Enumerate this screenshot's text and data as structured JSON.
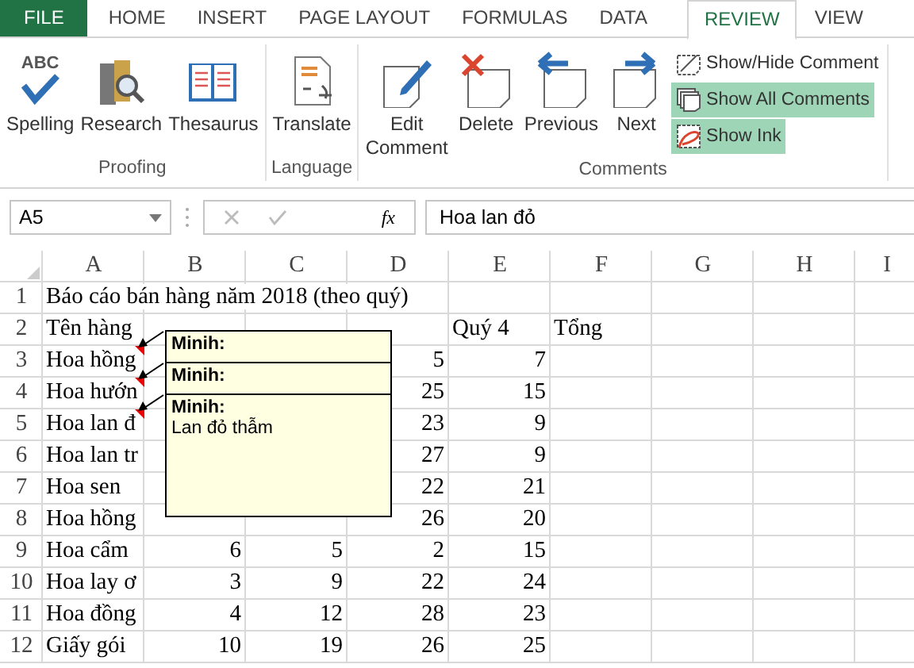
{
  "tabs": [
    {
      "label": "FILE",
      "kind": "file",
      "selected": false
    },
    {
      "label": "HOME",
      "kind": "tab",
      "selected": false
    },
    {
      "label": "INSERT",
      "kind": "tab",
      "selected": false
    },
    {
      "label": "PAGE LAYOUT",
      "kind": "tab",
      "selected": false
    },
    {
      "label": "FORMULAS",
      "kind": "tab",
      "selected": false
    },
    {
      "label": "DATA",
      "kind": "tab",
      "selected": false
    },
    {
      "label": "REVIEW",
      "kind": "tab",
      "selected": true
    },
    {
      "label": "VIEW",
      "kind": "tab",
      "selected": false
    }
  ],
  "ribbon": {
    "groups": [
      {
        "label": "Proofing",
        "buttons": [
          {
            "label": "Spelling",
            "kind": "spelling",
            "icon_text": "ABC"
          },
          {
            "label": "Research",
            "kind": "research"
          },
          {
            "label": "Thesaurus",
            "kind": "thesaurus"
          }
        ]
      },
      {
        "label": "Language",
        "buttons": [
          {
            "label": "Translate",
            "kind": "translate"
          }
        ]
      },
      {
        "label": "Comments",
        "buttons": [
          {
            "label": "Edit Comment",
            "kind": "edit"
          },
          {
            "label": "Delete",
            "kind": "delete"
          },
          {
            "label": "Previous",
            "kind": "previous"
          },
          {
            "label": "Next",
            "kind": "next"
          }
        ],
        "toggles": [
          {
            "label": "Show/Hide Comment",
            "kind": "showhide",
            "selected": false
          },
          {
            "label": "Show All Comments",
            "kind": "showall",
            "selected": true
          },
          {
            "label": "Show Ink",
            "kind": "ink",
            "selected": true
          }
        ]
      }
    ]
  },
  "formula_bar": {
    "name_box": "A5",
    "function_label": "fx",
    "value": "Hoa lan đỏ"
  },
  "sheet": {
    "columns": [
      "A",
      "B",
      "C",
      "D",
      "E",
      "F",
      "G",
      "H",
      "I"
    ],
    "rows": [
      {
        "header": "1",
        "cells": {
          "A": {
            "text": "Báo cáo bán hàng năm 2018 (theo quý)",
            "kind": "text"
          }
        }
      },
      {
        "header": "2",
        "cells": {
          "A": {
            "text": "Tên hàng",
            "kind": "text"
          },
          "E": {
            "text": "Quý 4",
            "kind": "text"
          },
          "F": {
            "text": "Tổng",
            "kind": "text"
          }
        }
      },
      {
        "header": "3",
        "comment": true,
        "cells": {
          "A": {
            "text": "Hoa hồng",
            "kind": "text"
          },
          "D": {
            "text": "5",
            "kind": "number"
          },
          "E": {
            "text": "7",
            "kind": "number"
          }
        }
      },
      {
        "header": "4",
        "comment": true,
        "cells": {
          "A": {
            "text": "Hoa hướn",
            "kind": "text"
          },
          "D": {
            "text": "25",
            "kind": "number"
          },
          "E": {
            "text": "15",
            "kind": "number"
          }
        }
      },
      {
        "header": "5",
        "comment": true,
        "cells": {
          "A": {
            "text": "Hoa lan đ",
            "kind": "text"
          },
          "D": {
            "text": "23",
            "kind": "number"
          },
          "E": {
            "text": "9",
            "kind": "number"
          }
        }
      },
      {
        "header": "6",
        "cells": {
          "A": {
            "text": "Hoa lan tr",
            "kind": "text"
          },
          "D": {
            "text": "27",
            "kind": "number"
          },
          "E": {
            "text": "9",
            "kind": "number"
          }
        }
      },
      {
        "header": "7",
        "cells": {
          "A": {
            "text": "Hoa sen",
            "kind": "text"
          },
          "D": {
            "text": "22",
            "kind": "number"
          },
          "E": {
            "text": "21",
            "kind": "number"
          }
        }
      },
      {
        "header": "8",
        "cells": {
          "A": {
            "text": "Hoa hồng",
            "kind": "text"
          },
          "D": {
            "text": "26",
            "kind": "number"
          },
          "E": {
            "text": "20",
            "kind": "number"
          }
        }
      },
      {
        "header": "9",
        "cells": {
          "A": {
            "text": "Hoa cẩm",
            "kind": "text"
          },
          "B": {
            "text": "6",
            "kind": "number"
          },
          "C": {
            "text": "5",
            "kind": "number"
          },
          "D": {
            "text": "2",
            "kind": "number"
          },
          "E": {
            "text": "15",
            "kind": "number"
          }
        }
      },
      {
        "header": "10",
        "cells": {
          "A": {
            "text": "Hoa lay ơ",
            "kind": "text"
          },
          "B": {
            "text": "3",
            "kind": "number"
          },
          "C": {
            "text": "9",
            "kind": "number"
          },
          "D": {
            "text": "22",
            "kind": "number"
          },
          "E": {
            "text": "24",
            "kind": "number"
          }
        }
      },
      {
        "header": "11",
        "cells": {
          "A": {
            "text": "Hoa đồng",
            "kind": "text"
          },
          "B": {
            "text": "4",
            "kind": "number"
          },
          "C": {
            "text": "12",
            "kind": "number"
          },
          "D": {
            "text": "28",
            "kind": "number"
          },
          "E": {
            "text": "23",
            "kind": "number"
          }
        }
      },
      {
        "header": "12",
        "cells": {
          "A": {
            "text": "Giấy gói",
            "kind": "text"
          },
          "B": {
            "text": "10",
            "kind": "number"
          },
          "C": {
            "text": "19",
            "kind": "number"
          },
          "D": {
            "text": "26",
            "kind": "number"
          },
          "E": {
            "text": "25",
            "kind": "number"
          }
        }
      }
    ],
    "comments": [
      {
        "author": "Minih:"
      },
      {
        "author": "Minih:"
      },
      {
        "author": "Minih:",
        "text": "Lan đỏ thẫm"
      }
    ]
  }
}
